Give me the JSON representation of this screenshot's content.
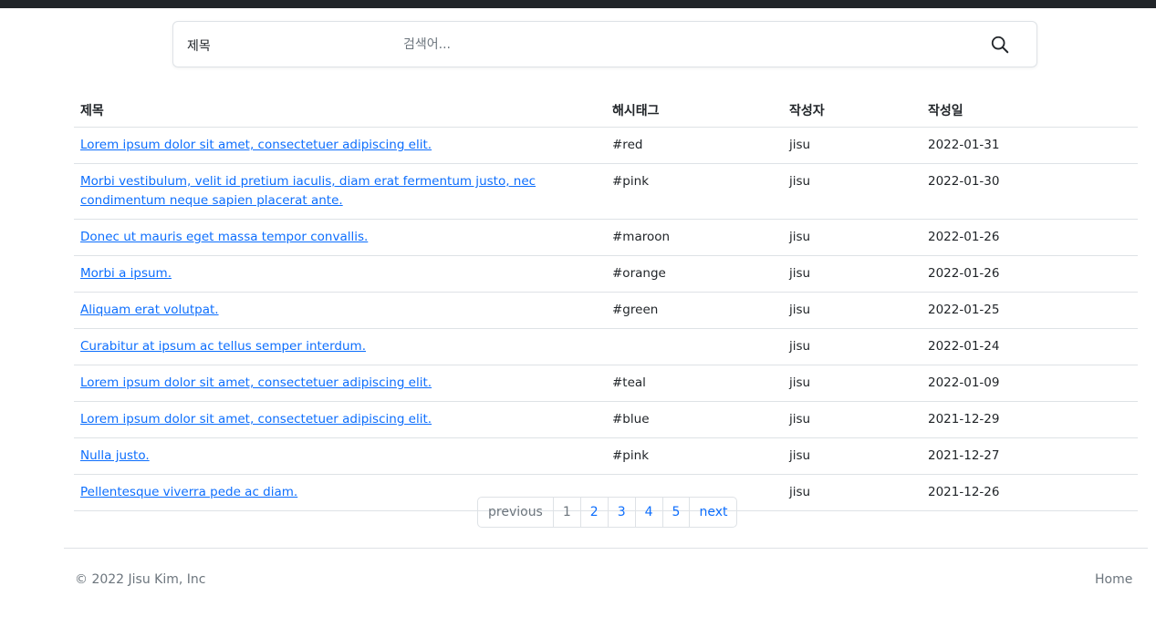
{
  "search": {
    "type_label": "제목",
    "placeholder": "검색어..."
  },
  "table": {
    "headers": [
      "제목",
      "해시태그",
      "작성자",
      "작성일"
    ],
    "rows": [
      {
        "title": "Lorem ipsum dolor sit amet, consectetuer adipiscing elit.",
        "hashtag": "#red",
        "author": "jisu",
        "date": "2022-01-31"
      },
      {
        "title": "Morbi vestibulum, velit id pretium iaculis, diam erat fermentum justo, nec condimentum neque sapien placerat ante.",
        "hashtag": "#pink",
        "author": "jisu",
        "date": "2022-01-30"
      },
      {
        "title": "Donec ut mauris eget massa tempor convallis.",
        "hashtag": "#maroon",
        "author": "jisu",
        "date": "2022-01-26"
      },
      {
        "title": "Morbi a ipsum.",
        "hashtag": "#orange",
        "author": "jisu",
        "date": "2022-01-26"
      },
      {
        "title": "Aliquam erat volutpat.",
        "hashtag": "#green",
        "author": "jisu",
        "date": "2022-01-25"
      },
      {
        "title": "Curabitur at ipsum ac tellus semper interdum.",
        "hashtag": "",
        "author": "jisu",
        "date": "2022-01-24"
      },
      {
        "title": "Lorem ipsum dolor sit amet, consectetuer adipiscing elit.",
        "hashtag": "#teal",
        "author": "jisu",
        "date": "2022-01-09"
      },
      {
        "title": "Lorem ipsum dolor sit amet, consectetuer adipiscing elit.",
        "hashtag": "#blue",
        "author": "jisu",
        "date": "2021-12-29"
      },
      {
        "title": "Nulla justo.",
        "hashtag": "#pink",
        "author": "jisu",
        "date": "2021-12-27"
      },
      {
        "title": "Pellentesque viverra pede ac diam.",
        "hashtag": "",
        "author": "jisu",
        "date": "2021-12-26"
      }
    ]
  },
  "pagination": {
    "previous": "previous",
    "pages": [
      "1",
      "2",
      "3",
      "4",
      "5"
    ],
    "next": "next"
  },
  "footer": {
    "copyright": "© 2022 Jisu Kim, Inc",
    "home": "Home"
  },
  "icons": {
    "search": "search-icon"
  },
  "colors": {
    "link": "#0d6efd",
    "muted": "#6c757d",
    "topbar": "#212529"
  }
}
